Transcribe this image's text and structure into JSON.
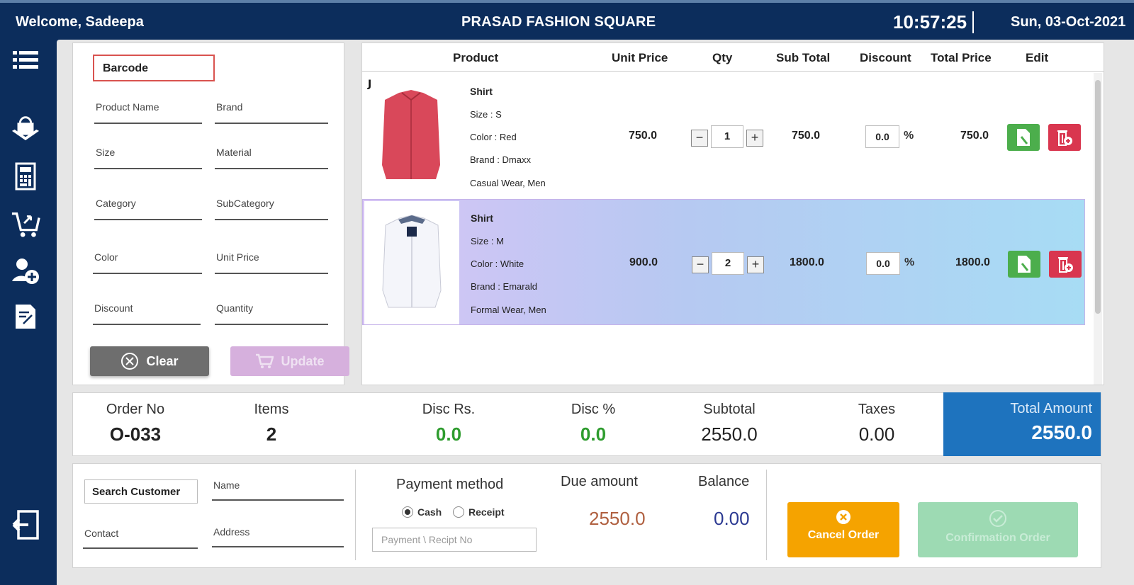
{
  "header": {
    "welcome": "Welcome, Sadeepa",
    "shop_name": "PRASAD FASHION SQUARE",
    "time": "10:57:25",
    "date": "Sun, 03-Oct-2021"
  },
  "sidebar": {
    "items": [
      {
        "icon": "menu-icon"
      },
      {
        "icon": "shopping-bag-icon"
      },
      {
        "icon": "calculator-icon"
      },
      {
        "icon": "cart-return-icon"
      },
      {
        "icon": "add-user-icon"
      },
      {
        "icon": "edit-document-icon"
      },
      {
        "icon": "logout-icon"
      }
    ]
  },
  "product_form": {
    "barcode_label": "Barcode",
    "fields": {
      "product_name": "Product Name",
      "brand": "Brand",
      "size": "Size",
      "material": "Material",
      "category": "Category",
      "subcategory": "SubCategory",
      "color": "Color",
      "unit_price": "Unit Price",
      "discount": "Discount",
      "quantity": "Quantity"
    },
    "clear_label": "Clear",
    "update_label": "Update"
  },
  "cart": {
    "columns": [
      "Product",
      "Unit Price",
      "Qty",
      "Sub Total",
      "Discount",
      "Total Price",
      "Edit"
    ],
    "rows": [
      {
        "name": "Shirt",
        "size": "Size   :   S",
        "color": "Color :   Red",
        "brand": "Brand :  Dmaxx",
        "category": "Casual Wear, Men",
        "unit_price": "750.0",
        "qty": "1",
        "sub_total": "750.0",
        "discount": "0.0",
        "pct": "%",
        "total": "750.0",
        "shirt_color": "#d9485a",
        "brand_logo": "J"
      },
      {
        "name": "Shirt",
        "size": "Size   :   M",
        "color": "Color :   White",
        "brand": "Brand :  Emarald",
        "category": "Formal Wear, Men",
        "unit_price": "900.0",
        "qty": "2",
        "sub_total": "1800.0",
        "discount": "0.0",
        "pct": "%",
        "total": "1800.0",
        "shirt_color": "#f4f5fa"
      }
    ]
  },
  "summary": {
    "order_no_label": "Order No",
    "order_no": "O-033",
    "items_label": "Items",
    "items": "2",
    "disc_rs_label": "Disc Rs.",
    "disc_rs": "0.0",
    "disc_pct_label": "Disc %",
    "disc_pct": "0.0",
    "subtotal_label": "Subtotal",
    "subtotal": "2550.0",
    "taxes_label": "Taxes",
    "taxes": "0.00",
    "total_label": "Total Amount",
    "total": "2550.0"
  },
  "checkout": {
    "search_customer": "Search Customer",
    "name_label": "Name",
    "contact_label": "Contact",
    "address_label": "Address",
    "payment_title": "Payment method",
    "cash_label": "Cash",
    "receipt_label": "Receipt",
    "payment_placeholder": "Payment \\ Recipt No",
    "due_label": "Due amount",
    "due_value": "2550.0",
    "balance_label": "Balance",
    "balance_value": "0.00",
    "cancel_label": "Cancel Order",
    "confirm_label": "Confirmation Order"
  },
  "colors": {
    "navy": "#0c2d5c",
    "accent_blue": "#1e73be",
    "green": "#4cae4c",
    "red": "#d9364f",
    "orange": "#f5a300",
    "discount_green": "#2e9c2e"
  }
}
